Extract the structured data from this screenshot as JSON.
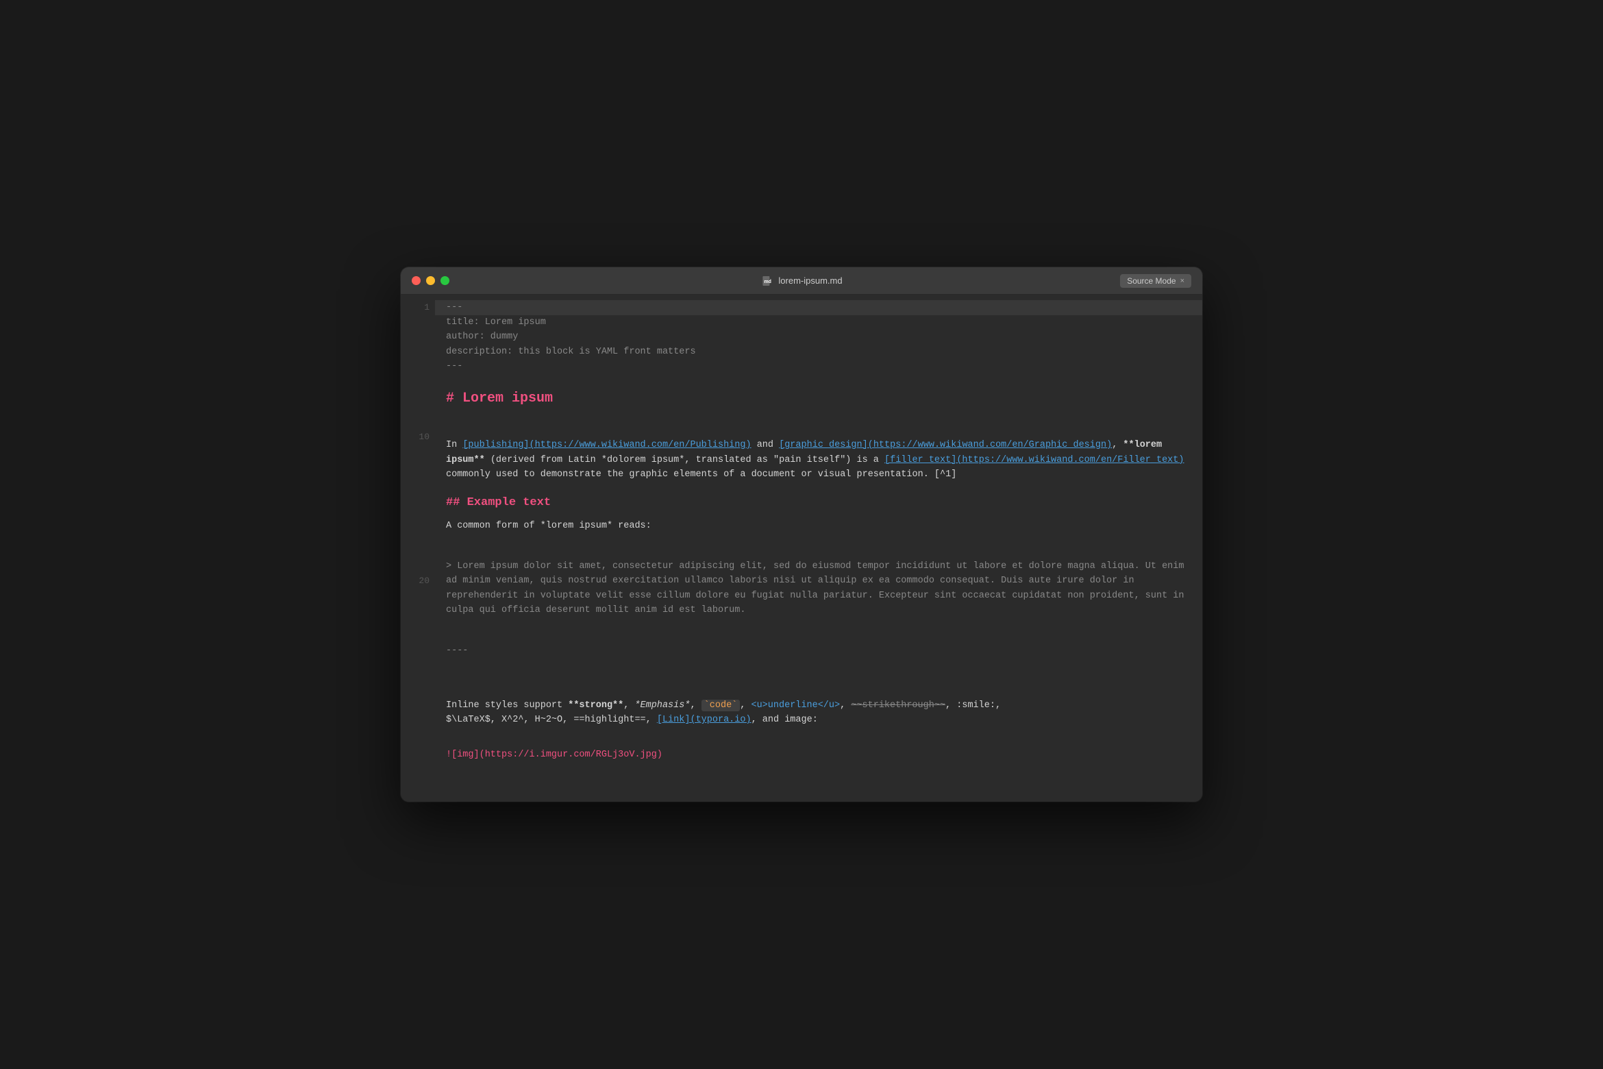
{
  "window": {
    "title": "lorem-ipsum.md",
    "source_mode_label": "Source Mode",
    "source_mode_close": "×"
  },
  "traffic_lights": {
    "close_color": "#ff5f57",
    "minimize_color": "#febc2e",
    "maximize_color": "#28c840"
  },
  "editor": {
    "line_numbers": [
      "1",
      "",
      "",
      "",
      "",
      "",
      "",
      "",
      "",
      "10",
      "",
      "",
      "",
      "",
      "",
      "",
      "",
      "",
      "",
      "20",
      "",
      "",
      "",
      "",
      "",
      ""
    ],
    "yaml_separator_1": "---",
    "yaml_title": "title: Lorem ipsum",
    "yaml_author": "author: dummy",
    "yaml_description": "description: this block is YAML front matters",
    "yaml_separator_2": "---",
    "h1": "# Lorem ipsum",
    "para1_start": "In ",
    "para1_link1": "[publishing](https://www.wikiwand.com/en/Publishing)",
    "para1_and": " and ",
    "para1_link2": "[graphic design]",
    "para1_link2b": "(https://www.wikiwand.com/en/Graphic_design)",
    "para1_comma": ", ",
    "para1_bold": "**lorem ipsum**",
    "para1_text": " (derived from Latin *dolorem ipsum*, translated as \"pain itself\") is a ",
    "para1_link3": "[filler text](https://www.wikiwand.com/en/Filler_text)",
    "para1_end": " commonly used to demonstrate the graphic elements of a document or visual presentation. [^1]",
    "h2": "## Example text",
    "para2": "A common form of *lorem ipsum* reads:",
    "blockquote": ">  Lorem ipsum dolor sit amet, consectetur adipiscing elit, sed do eiusmod tempor incididunt ut labore et dolore magna aliqua. Ut enim ad minim veniam, quis nostrud exercitation ullamco laboris nisi ut aliquip ex ea commodo consequat. Duis aute irure dolor in reprehenderit in voluptate velit esse cillum dolore eu fugiat nulla pariatur. Excepteur sint occaecat cupidatat non proident, sunt in culpa qui officia deserunt mollit anim id est laborum.",
    "separator": "----",
    "inline_start": "Inline styles support ",
    "inline_bold": "**strong**",
    "inline_comma1": ", ",
    "inline_italic": "*Emphasis*",
    "inline_comma2": ", ",
    "inline_code": "`code`",
    "inline_comma3": ", ",
    "inline_html": "<u>underline</u>",
    "inline_comma4": ", ",
    "inline_strike": "~~strikethrough~~",
    "inline_comma5": ", :smile:,",
    "inline_latex": "$\\LaTeX$, X^2^, H~2~O, ==highlight==, ",
    "inline_link": "[Link](typora.io)",
    "inline_end": ", and image:",
    "image_link": "![img](https://i.imgur.com/RGLj3oV.jpg)"
  }
}
